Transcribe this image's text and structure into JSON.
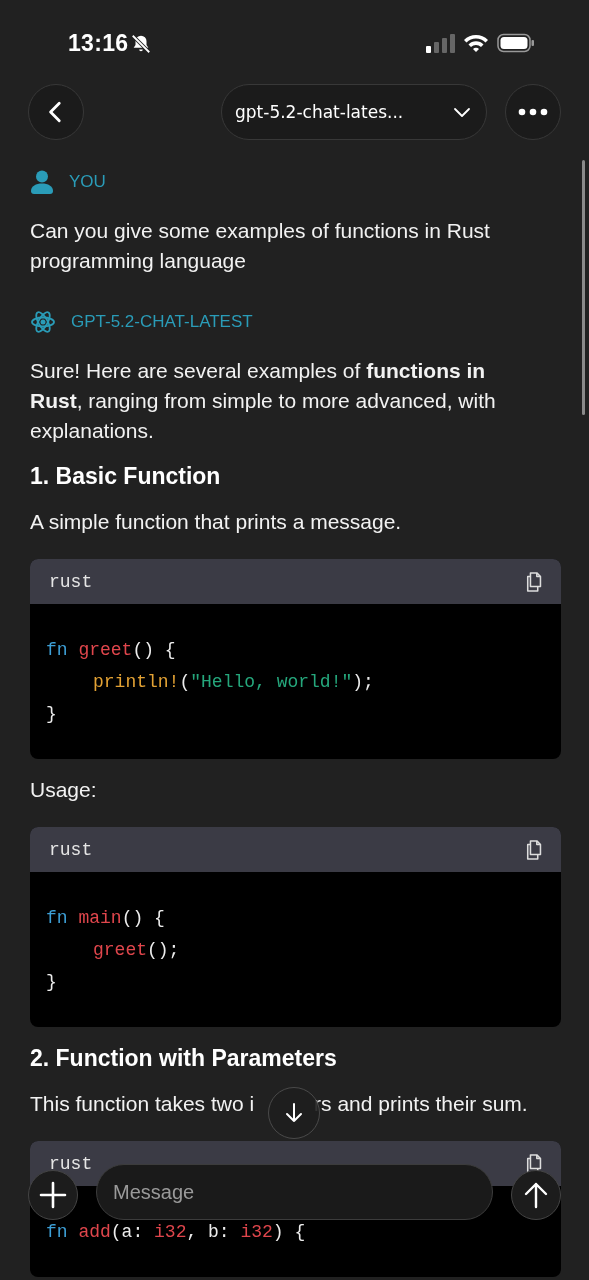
{
  "status_bar": {
    "time": "13:16",
    "silent": true
  },
  "header": {
    "model": "gpt-5.2-chat-lates..."
  },
  "messages": [
    {
      "kind": "user",
      "author": "YOU",
      "blocks": [
        {
          "kind": "paragraph",
          "text": "Can you give some examples of functions in Rust programming language"
        }
      ]
    },
    {
      "kind": "assistant",
      "author": "GPT-5.2-CHAT-LATEST",
      "blocks": [
        {
          "kind": "paragraph",
          "text": "Sure! Here are several examples of **functions in Rust**, ranging from simple to more advanced, with explanations."
        },
        {
          "kind": "heading",
          "text": "1. Basic Function"
        },
        {
          "kind": "paragraph",
          "text": "A simple function that prints a message."
        },
        {
          "kind": "code",
          "language": "rust",
          "lines": [
            {
              "indented": false,
              "tokens": [
                {
                  "kind": "keyword",
                  "text": "fn "
                },
                {
                  "kind": "func",
                  "text": "greet"
                },
                {
                  "kind": "plain",
                  "text": "() {"
                }
              ]
            },
            {
              "indented": true,
              "tokens": [
                {
                  "kind": "macro",
                  "text": "println!"
                },
                {
                  "kind": "plain",
                  "text": "("
                },
                {
                  "kind": "string",
                  "text": "\"Hello, world!\""
                },
                {
                  "kind": "plain",
                  "text": ");"
                }
              ]
            },
            {
              "indented": false,
              "tokens": [
                {
                  "kind": "plain",
                  "text": "}"
                }
              ]
            }
          ]
        },
        {
          "kind": "paragraph",
          "text": "Usage:"
        },
        {
          "kind": "code",
          "language": "rust",
          "lines": [
            {
              "indented": false,
              "tokens": [
                {
                  "kind": "keyword",
                  "text": "fn "
                },
                {
                  "kind": "func",
                  "text": "main"
                },
                {
                  "kind": "plain",
                  "text": "() {"
                }
              ]
            },
            {
              "indented": true,
              "tokens": [
                {
                  "kind": "func",
                  "text": "greet"
                },
                {
                  "kind": "plain",
                  "text": "();"
                }
              ]
            },
            {
              "indented": false,
              "tokens": [
                {
                  "kind": "plain",
                  "text": "}"
                }
              ]
            }
          ]
        },
        {
          "kind": "heading",
          "text": "2. Function with Parameters"
        },
        {
          "kind": "split",
          "parts": [
            "This function takes two i",
            "rs and prints their sum."
          ]
        },
        {
          "kind": "code",
          "language": "rust",
          "lines": [
            {
              "indented": false,
              "tokens": [
                {
                  "kind": "keyword",
                  "text": "fn "
                },
                {
                  "kind": "func",
                  "text": "add"
                },
                {
                  "kind": "plain",
                  "text": "(a: "
                },
                {
                  "kind": "func",
                  "text": "i32"
                },
                {
                  "kind": "plain",
                  "text": ", b: "
                },
                {
                  "kind": "func",
                  "text": "i32"
                },
                {
                  "kind": "plain",
                  "text": ") {"
                }
              ]
            }
          ]
        }
      ]
    }
  ],
  "composer": {
    "placeholder": "Message"
  }
}
